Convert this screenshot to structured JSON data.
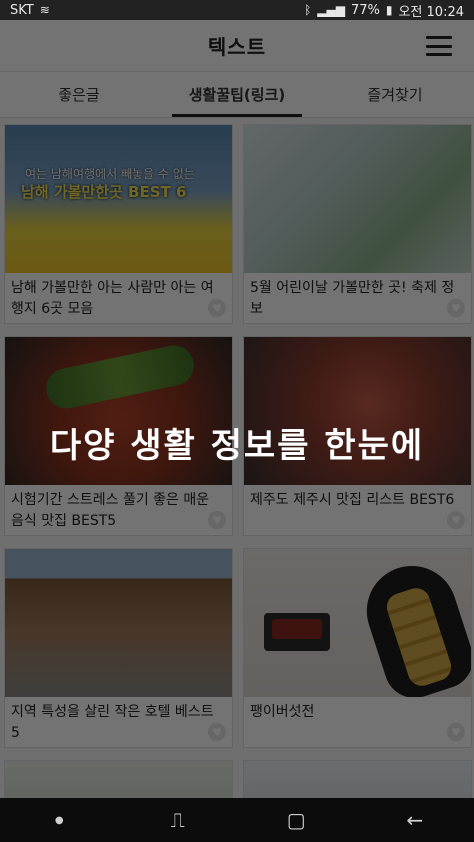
{
  "statusbar": {
    "carrier": "SKT",
    "battery": "77%",
    "time_label": "오전 10:24"
  },
  "app": {
    "title": "텍스트"
  },
  "tabs": [
    {
      "label": "좋은글"
    },
    {
      "label": "생활꿀팁(링크)"
    },
    {
      "label": "즐겨찾기"
    }
  ],
  "cards": [
    {
      "caption": "남해 가볼만한 아는 사람만 아는 여행지 6곳 모음",
      "thumb_banner": "여는 남해여행에서 빼놓을 수 없는",
      "thumb_headline": "남해 가볼만한곳 BEST 6"
    },
    {
      "caption": "5월 어린이날 가볼만한 곳! 축제 정보"
    },
    {
      "caption": "시험기간 스트레스 풀기 좋은 매운 음식 맛집 BEST5"
    },
    {
      "caption": "제주도 제주시 맛집 리스트 BEST6"
    },
    {
      "caption": "지역 특성을 살린 작은 호텔 베스트 5"
    },
    {
      "caption": "팽이버섯전"
    }
  ],
  "overlay": {
    "text": "다양 생활 정보를 한눈에"
  },
  "icons": {
    "heart": "heart-icon",
    "menu": "hamburger-menu-icon",
    "nav_recent": "recent-apps-icon",
    "nav_home": "home-icon",
    "nav_back": "back-icon"
  }
}
